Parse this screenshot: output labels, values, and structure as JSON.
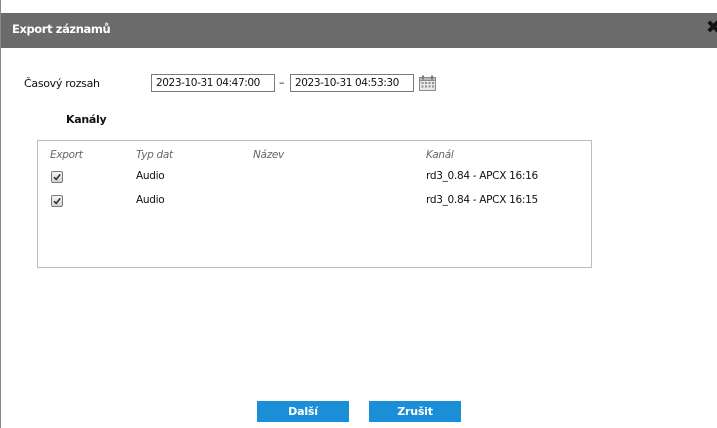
{
  "dialog": {
    "title": "Export záznamů",
    "close_icon": "close-icon"
  },
  "time_range": {
    "label": "Časový rozsah",
    "from": "2023-10-31 04:47:00",
    "separator": "–",
    "to": "2023-10-31 04:53:30",
    "calendar_icon": "calendar-icon"
  },
  "channels": {
    "label": "Kanály",
    "columns": [
      "Export",
      "Typ dat",
      "Název",
      "Kanál"
    ],
    "rows": [
      {
        "export": true,
        "type": "Audio",
        "name": "",
        "channel": "rd3_0.84 - APCX 16:16"
      },
      {
        "export": true,
        "type": "Audio",
        "name": "",
        "channel": "rd3_0.84 - APCX 16:15"
      }
    ]
  },
  "buttons": {
    "next": "Další",
    "cancel": "Zrušit"
  },
  "colors": {
    "titlebar": "#6b6b6b",
    "button": "#1a8fd8"
  }
}
